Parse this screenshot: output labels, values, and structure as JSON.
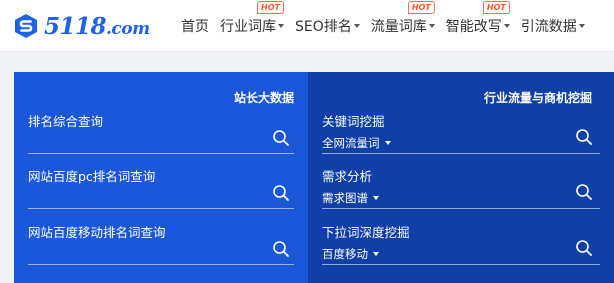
{
  "brand": {
    "logo_text": "5118",
    "logo_suffix": ".com",
    "logo_icon": "s-logo-icon",
    "color": "#1e63e6"
  },
  "nav": {
    "items": [
      {
        "label": "首页",
        "dropdown": false,
        "hot": ""
      },
      {
        "label": "行业词库",
        "dropdown": true,
        "hot": "HOT"
      },
      {
        "label": "SEO排名",
        "dropdown": true,
        "hot": ""
      },
      {
        "label": "流量词库",
        "dropdown": true,
        "hot": "HOT"
      },
      {
        "label": "智能改写",
        "dropdown": true,
        "hot": "HOT"
      },
      {
        "label": "引流数据",
        "dropdown": true,
        "hot": ""
      }
    ]
  },
  "panel": {
    "left": {
      "title": "站长大数据",
      "rows": [
        {
          "label": "排名综合查询",
          "icon": "search-icon"
        },
        {
          "label": "网站百度pc排名词查询",
          "icon": "search-icon"
        },
        {
          "label": "网站百度移动排名词查询",
          "icon": "search-icon"
        }
      ]
    },
    "right": {
      "title": "行业流量与商机挖掘",
      "rows": [
        {
          "label": "关键词挖掘",
          "select": "全网流量词",
          "icon": "search-icon"
        },
        {
          "label": "需求分析",
          "select": "需求图谱",
          "icon": "search-icon"
        },
        {
          "label": "下拉词深度挖掘",
          "select": "百度移动",
          "icon": "search-icon"
        }
      ]
    },
    "colors": {
      "left_bg": "#1b57d9",
      "right_bg": "#103fa8",
      "hot": "#ff5a36"
    }
  }
}
